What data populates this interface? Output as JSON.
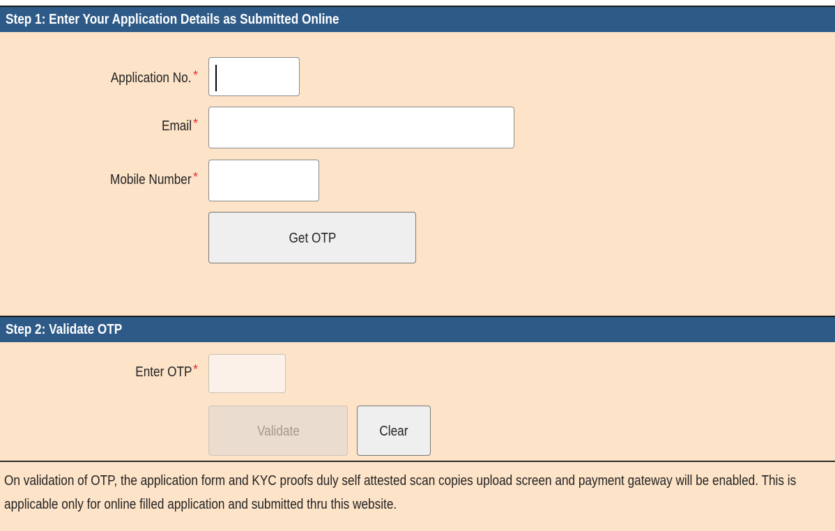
{
  "step1": {
    "header": "Step 1: Enter Your Application Details as Submitted Online",
    "application_no_label": "Application No.",
    "email_label": "Email",
    "mobile_label": "Mobile Number",
    "required_mark": "*",
    "application_no_value": "",
    "email_value": "",
    "mobile_value": "",
    "get_otp_label": "Get OTP"
  },
  "step2": {
    "header": "Step 2: Validate OTP",
    "otp_label": "Enter OTP",
    "required_mark": "*",
    "otp_value": "",
    "validate_label": "Validate",
    "clear_label": "Clear"
  },
  "footer": {
    "note": "On validation of OTP, the application form and KYC proofs duly self attested scan copies upload screen and payment gateway will be enabled. This is applicable only for online filled application and submitted thru this website."
  },
  "colors": {
    "header_bg": "#2e5a87",
    "panel_bg": "#fde3c8",
    "required": "#e03030"
  }
}
